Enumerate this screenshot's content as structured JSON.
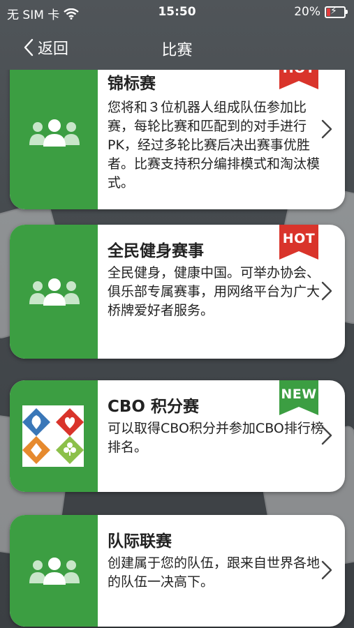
{
  "status_bar": {
    "carrier": "无 SIM 卡",
    "time": "15:50",
    "battery_percent": "20%",
    "battery_level": 0.2,
    "icons": [
      "wifi-icon",
      "battery-charging-icon"
    ]
  },
  "nav": {
    "back_label": "返回",
    "title": "比赛"
  },
  "items": [
    {
      "title": "锦标赛",
      "badge": "HOT",
      "badge_color": "#d9342b",
      "icon": "people-icon",
      "description": "您将和３位机器人组成队伍参加比赛，每轮比赛和匹配到的对手进行PK，经过多轮比赛后决出赛事优胜者。比赛支持积分编排模式和淘汰模式。"
    },
    {
      "title": "全民健身赛事",
      "badge": "HOT",
      "badge_color": "#d9342b",
      "icon": "people-icon",
      "description": "全民健身，健康中国。可举办协会、俱乐部专属赛事，用网络平台为广大桥牌爱好者服务。"
    },
    {
      "title": "CBO 积分赛",
      "badge": "NEW",
      "badge_color": "#3c9e42",
      "icon": "cbo-logo-icon",
      "description": "可以取得CBO积分并参加CBO排行榜排名。"
    },
    {
      "title": "队际联赛",
      "badge": "",
      "icon": "people-icon",
      "description": "创建属于您的队伍，跟来自世界各地的队伍一决高下。"
    }
  ],
  "colors": {
    "accent_green": "#3c9e42",
    "hot_red": "#d9342b"
  }
}
